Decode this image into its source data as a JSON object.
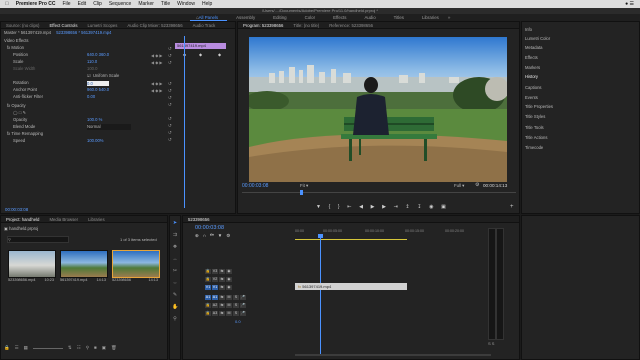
{
  "menubar": {
    "app": "Premiere Pro CC",
    "items": [
      "File",
      "Edit",
      "Clip",
      "Sequence",
      "Marker",
      "Title",
      "Window",
      "Help"
    ]
  },
  "path_title": "/Users/..../Documents/Adobe/Premiere Pro/11.0/handheld.prproj *",
  "workspaces": [
    "Assembly",
    "Editing",
    "Color",
    "Effects",
    "Audio",
    "Titles",
    "Libraries"
  ],
  "workspace_active": "All Panels",
  "effect_controls": {
    "tabs": [
      "Source: (no clips)",
      "Effect Controls",
      "Lumetri Scopes",
      "Audio Clip Mixer: 523398656",
      "Audio Track"
    ],
    "header": "Master * 561397419.mp4",
    "sequence": "523398656 * 561397419.mp4",
    "section": "Video Effects",
    "clip_label": "561397419.mp4",
    "rows": [
      {
        "name": "fx Motion",
        "value": ""
      },
      {
        "name": "Position",
        "value": "640.0   360.0"
      },
      {
        "name": "Scale",
        "value": "110.0"
      },
      {
        "name": "Scale Width",
        "value": "100.0"
      },
      {
        "name": "Uniform Scale",
        "value": ""
      },
      {
        "name": "Rotation",
        "value": "0.0"
      },
      {
        "name": "Anchor Point",
        "value": "960.0   540.0"
      },
      {
        "name": "Anti-flicker Filter",
        "value": "0.00"
      },
      {
        "name": "fx Opacity",
        "value": ""
      },
      {
        "name": "Opacity",
        "value": "100.0 %"
      },
      {
        "name": "Blend Mode",
        "value": "Normal"
      },
      {
        "name": "fx Time Remapping",
        "value": ""
      },
      {
        "name": "Speed",
        "value": "100.00%"
      }
    ],
    "timecode": "00:00:03:08"
  },
  "program_monitor": {
    "tabs": [
      "Program: 523398656",
      "Title: (no title)",
      "Reference: 523398656"
    ],
    "timecode": "00:00:03:08",
    "fit": "Fit",
    "quality": "Full",
    "duration": "00:00:14:13"
  },
  "right_panel": {
    "items": [
      "Info",
      "Lumetri Color",
      "Metadata",
      "Effects",
      "Markers",
      "History",
      "Captions",
      "Events",
      "Title Properties",
      "Title Styles",
      "Title Tools",
      "Title Actions",
      "Timecode"
    ]
  },
  "project": {
    "tabs": [
      "Project: handheld",
      "Media Browser",
      "Libraries"
    ],
    "project_file": "handheld.prproj",
    "selected_info": "1 of 3 items selected",
    "items": [
      {
        "name": "523398656.mp4",
        "duration": "10:23"
      },
      {
        "name": "561397419.mp4",
        "duration": "14:13"
      },
      {
        "name": "523398656",
        "duration": "14:13"
      }
    ]
  },
  "timeline": {
    "sequence_tab": "523398656",
    "timecode": "00:00:03:08",
    "ruler": [
      "00:00",
      "00:00:05:00",
      "00:00:10:00",
      "00:00:15:00",
      "00:00:20:00"
    ],
    "video_tracks": [
      "V3",
      "V2",
      "V1"
    ],
    "audio_tracks": [
      "A1",
      "A2",
      "A3"
    ],
    "clip_name": "561397419.mp4",
    "audio_level": "0.0"
  }
}
